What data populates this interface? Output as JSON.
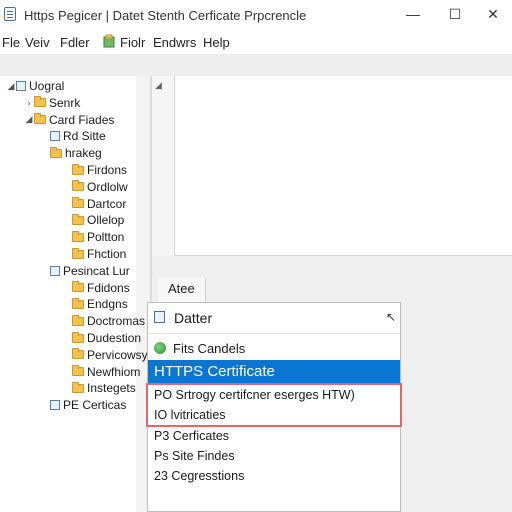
{
  "window": {
    "title": "Https Pegicer | Datet Stenth Cerficate Prpcrencle",
    "minimize": "—",
    "maximize": "☐",
    "close": "✕"
  },
  "menu": {
    "items": [
      "Fle",
      "Veiv",
      "Fdler",
      "Fiolr",
      "Endwrs",
      "Help"
    ]
  },
  "tree": {
    "rows": [
      {
        "label": "Uogral",
        "chevron": "◢",
        "icon": "node",
        "indent": 1
      },
      {
        "label": "Senrk",
        "chevron": "›",
        "icon": "folder",
        "indent": 2
      },
      {
        "label": "Card Fiades",
        "chevron": "◢",
        "icon": "folder",
        "indent": 2
      },
      {
        "label": "Rd Sitte",
        "chevron": "",
        "icon": "node",
        "indent": 3
      },
      {
        "label": "hrakeg",
        "chevron": "",
        "icon": "folder",
        "indent": 3
      },
      {
        "label": "Firdons",
        "chevron": "",
        "icon": "folder",
        "indent": 4
      },
      {
        "label": "Ordlolw",
        "chevron": "",
        "icon": "folder",
        "indent": 4
      },
      {
        "label": "Dartcor",
        "chevron": "",
        "icon": "folder",
        "indent": 4
      },
      {
        "label": "Ollelop",
        "chevron": "",
        "icon": "folder",
        "indent": 4
      },
      {
        "label": "Poltton",
        "chevron": "",
        "icon": "folder",
        "indent": 4
      },
      {
        "label": "Fhction",
        "chevron": "",
        "icon": "folder",
        "indent": 4
      },
      {
        "label": "Pesincat Lur",
        "chevron": "",
        "icon": "node",
        "indent": 3
      },
      {
        "label": "Fdidons",
        "chevron": "",
        "icon": "folder",
        "indent": 4
      },
      {
        "label": "Endgns",
        "chevron": "",
        "icon": "folder",
        "indent": 4
      },
      {
        "label": "Doctromas",
        "chevron": "",
        "icon": "folder",
        "indent": 4
      },
      {
        "label": "Dudestion",
        "chevron": "",
        "icon": "folder",
        "indent": 4
      },
      {
        "label": "Pervicowsy",
        "chevron": "",
        "icon": "folder",
        "indent": 4
      },
      {
        "label": "Newfhiom",
        "chevron": "",
        "icon": "folder",
        "indent": 4
      },
      {
        "label": "Instegets",
        "chevron": "",
        "icon": "folder",
        "indent": 4
      },
      {
        "label": "PE Certicas",
        "chevron": "",
        "icon": "node",
        "indent": 3
      }
    ]
  },
  "right": {
    "tab_label": "Atee"
  },
  "dropdown": {
    "header": "Datter",
    "header_arrow": "↖",
    "option_with_icon": "Fits Candels",
    "selected": "HTTPS Certificate",
    "options": [
      "PO Srtrogy certifcner eserges HTW)",
      "IO lvitricaties",
      "P3 Cerficates",
      "Ps Site Findes",
      "23 Cegresstions"
    ]
  },
  "colors": {
    "accent": "#0a76d2",
    "highlight_outline": "#e06a6a",
    "folder": "#f2c14e"
  }
}
